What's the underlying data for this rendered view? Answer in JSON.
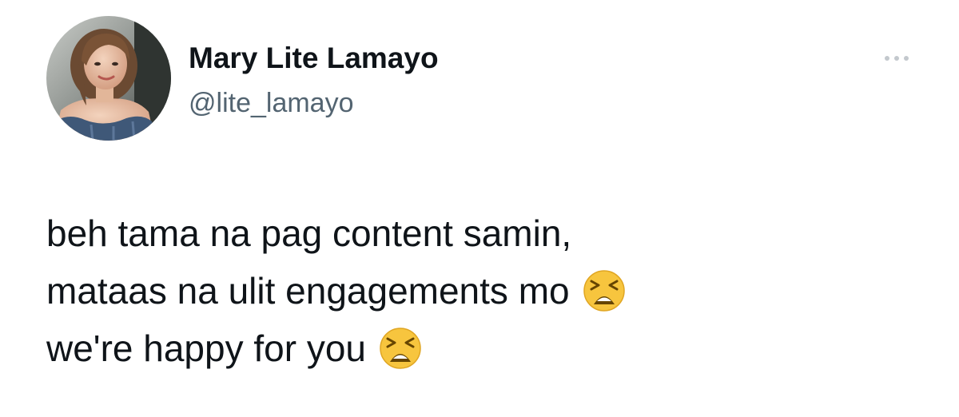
{
  "user": {
    "display_name": "Mary Lite Lamayo",
    "handle": "@lite_lamayo"
  },
  "tweet": {
    "lines": [
      "beh tama na pag content samin,",
      "mataas na ulit engagements mo",
      "we're happy for you"
    ]
  },
  "icons": {
    "more": "more-horizontal-icon",
    "emoji": "tired-face-emoji"
  },
  "colors": {
    "text": "#0f1419",
    "secondary_text": "#536471",
    "more_dots": "#c3c8cd",
    "background": "#ffffff"
  }
}
